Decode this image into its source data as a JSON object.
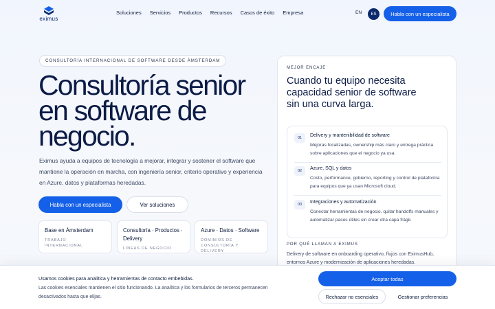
{
  "header": {
    "logo_text": "eximus",
    "nav": [
      "Soluciones",
      "Servicios",
      "Productos",
      "Recursos",
      "Casos de éxito",
      "Empresa"
    ],
    "lang_en": "EN",
    "lang_es": "ES",
    "cta": "Habla con un especialista"
  },
  "hero": {
    "kicker": "CONSULTORÍA INTERNACIONAL DE SOFTWARE DESDE ÁMSTERDAM",
    "title": "Consultoría senior en software de negocio.",
    "description": "Eximus ayuda a equipos de tecnología a mejorar, integrar y sostener el software que mantiene la operación en marcha, con ingeniería senior, criterio operativo y experiencia en Azure, datos y plataformas heredadas.",
    "primary_button": "Habla con un especialista",
    "secondary_button": "Ver soluciones",
    "stats": [
      {
        "title": "Base en Ámsterdam",
        "subtitle": "TRABAJO INTERNACIONAL"
      },
      {
        "title": "Consultoría · Productos · Delivery",
        "subtitle": "LÍNEAS DE NEGOCIO"
      },
      {
        "title": "Azure · Datos · Software",
        "subtitle": "DOMINIOS DE CONSULTORÍA Y DELIVERY"
      }
    ]
  },
  "card": {
    "kicker": "MEJOR ENCAJE",
    "title": "Cuando tu equipo necesita capacidad senior de software sin una curva larga.",
    "items": [
      {
        "num": "01",
        "title": "Delivery y mantenibilidad de software",
        "desc": "Mejoras focalizadas, ownership más claro y entrega práctica sobre aplicaciones que el negocio ya usa."
      },
      {
        "num": "02",
        "title": "Azure, SQL y datos",
        "desc": "Costo, performance, gobierno, reporting y control de plataforma para equipos que ya usan Microsoft cloud."
      },
      {
        "num": "03",
        "title": "Integraciones y automatización",
        "desc": "Conectar herramientas de negocio, quitar handoffs manuales y automatizar pasos útiles sin crear otra capa frágil."
      }
    ],
    "why_kicker": "POR QUÉ LLAMAN A EXIMUS",
    "why_text": "Delivery de software en onboarding operativo, flujos con EximusHub, entornos Azure y modernización de aplicaciones heredadas."
  },
  "cookie": {
    "title": "Usamos cookies para analítica y herramientas de contacto embebidas.",
    "text": "Las cookies esenciales mantienen el sitio funcionando. La analítica y los formularios de terceros permanecen desactivados hasta que elijas.",
    "accept": "Aceptar todas",
    "reject": "Rechazar no esenciales",
    "preferences": "Gestionar preferencias"
  },
  "colors": {
    "accent": "#1560e8",
    "navy": "#0b2a6b"
  }
}
